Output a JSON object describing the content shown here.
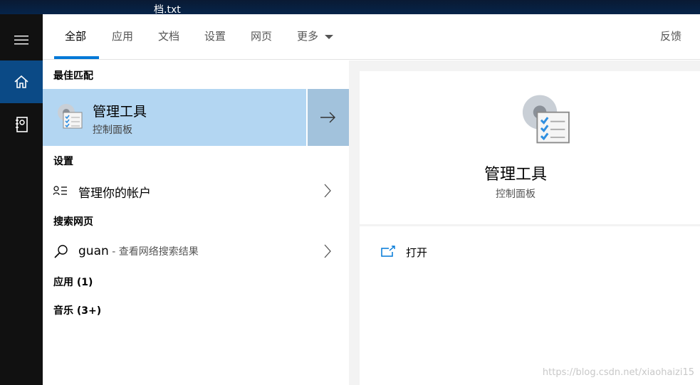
{
  "background_window": {
    "title_fragment": "档.txt"
  },
  "nav": {
    "items": [
      {
        "icon": "hamburger-icon"
      },
      {
        "icon": "home-icon",
        "selected": true
      },
      {
        "icon": "notebook-icon"
      }
    ]
  },
  "tabs": {
    "items": [
      "全部",
      "应用",
      "文档",
      "设置",
      "网页",
      "更多"
    ],
    "active": "全部",
    "feedback": "反馈"
  },
  "results": {
    "best_match_heading": "最佳匹配",
    "best_match": {
      "title": "管理工具",
      "subtitle": "控制面板"
    },
    "settings_heading": "设置",
    "settings_item": "管理你的帐户",
    "web_heading": "搜索网页",
    "web_query": "guan",
    "web_suffix": " - 查看网络搜索结果",
    "apps_heading": "应用 (1)",
    "music_heading": "音乐 (3+)"
  },
  "preview": {
    "title": "管理工具",
    "subtitle": "控制面板",
    "actions": [
      {
        "label": "打开",
        "icon": "open-external-icon"
      }
    ]
  },
  "watermark": "https://blog.csdn.net/xiaohaizi15",
  "colors": {
    "accent": "#0078d7",
    "selected_row": "#b3d6f2",
    "nav_selected": "#0b4a86"
  }
}
